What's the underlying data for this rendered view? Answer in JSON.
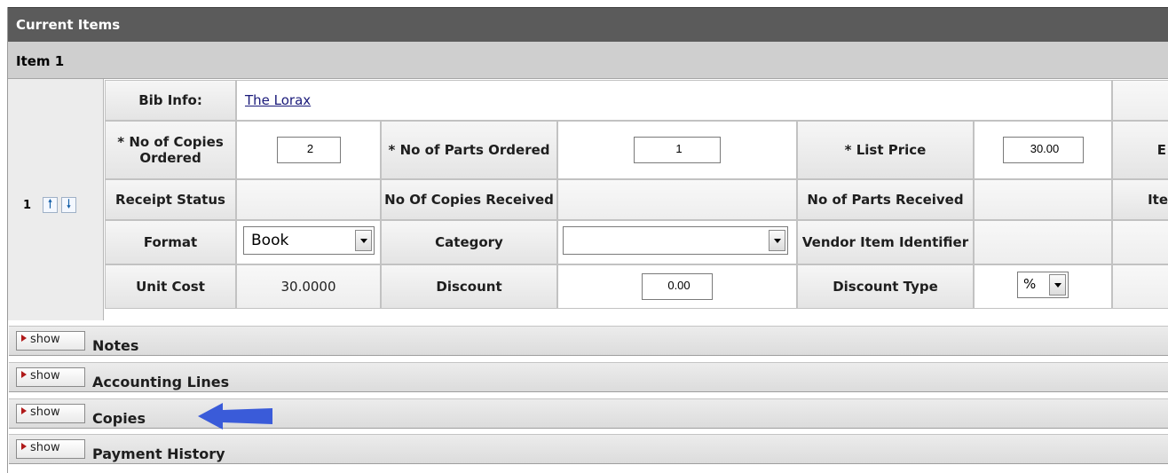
{
  "section_header": "Current Items",
  "item_header": "Item 1",
  "item_number": "1",
  "icons": {
    "move_up": "up-arrow-icon",
    "move_down": "down-arrow-icon",
    "pointer": "blue-arrow-icon"
  },
  "colors": {
    "header_bg": "#5b5b5b",
    "subheader_bg": "#cfcfcf",
    "arrow_color": "#3a5bd9",
    "link_color": "#1a1a7a"
  },
  "rows": {
    "bib_info": {
      "label": "Bib Info:",
      "value": "The Lorax"
    },
    "copies_ordered": {
      "label": "* No of Copies Ordered",
      "value": "2"
    },
    "parts_ordered": {
      "label": "* No of Parts Ordered",
      "value": "1"
    },
    "list_price": {
      "label": "* List Price",
      "value": "30.00"
    },
    "receipt_status": {
      "label": "Receipt Status",
      "value": ""
    },
    "copies_received": {
      "label": "No Of Copies Received",
      "value": ""
    },
    "parts_received": {
      "label": "No of Parts Received",
      "value": ""
    },
    "format": {
      "label": "Format",
      "value": "Book"
    },
    "category": {
      "label": "Category",
      "value": ""
    },
    "vendor_item_identifier": {
      "label": "Vendor Item Identifier",
      "value": ""
    },
    "unit_cost": {
      "label": "Unit Cost",
      "value": "30.0000"
    },
    "discount": {
      "label": "Discount",
      "value": "0.00"
    },
    "discount_type": {
      "label": "Discount Type",
      "value": "%"
    }
  },
  "cut_off_labels": {
    "row2": "E",
    "row3": "Ite"
  },
  "tabs": [
    {
      "button": "show",
      "title": "Notes"
    },
    {
      "button": "show",
      "title": "Accounting Lines"
    },
    {
      "button": "show",
      "title": "Copies"
    },
    {
      "button": "show",
      "title": "Payment History"
    }
  ]
}
